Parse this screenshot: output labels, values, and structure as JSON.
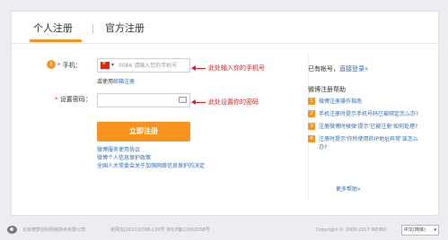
{
  "tabs": {
    "personal": "个人注册",
    "official": "官方注册"
  },
  "form": {
    "phone_label": "手机：",
    "phone_code": "0086",
    "phone_placeholder": "请输入您的手机号",
    "phone_annotation": "此处输入你的手机号",
    "email_link_prefix": "或使用",
    "email_link": "邮箱注册",
    "password_label": "设置密码：",
    "password_annotation": "此处设置你的密码",
    "submit_label": "立即注册",
    "links": [
      "微博服务使用协议",
      "微博个人信息保护政策",
      "全国人大常委会关于加强网络信息保护的决定"
    ],
    "warn_icon": "!"
  },
  "sidebar": {
    "has_account_prefix": "已有帐号，",
    "login_link": "直接登录»",
    "help_title": "微博注册帮助",
    "help_items": [
      {
        "num": "1",
        "text": "微博注册操作指南"
      },
      {
        "num": "2",
        "text": "手机注册时提示手机号码已被绑定怎么办?"
      },
      {
        "num": "3",
        "text": "注册微博时候弹'提示'已被注册'如何处理?"
      },
      {
        "num": "4",
        "text": "注册时提示'你所使用的IP地址异常'该怎么办?"
      }
    ],
    "more_help": "更多帮助»"
  },
  "footer": {
    "company": "北京微梦创科网络技术有限公司",
    "icp": "京网文[2011]0398-130号 京ICP备12002058号",
    "copyright": "Copyright © 2009-2017 WEIBO",
    "language": "中文(简体)"
  },
  "colors": {
    "accent": "#f7931e",
    "link": "#2c6bb5",
    "annotation": "#e02020"
  },
  "icons": [
    "warning-icon",
    "china-flag-icon",
    "keyboard-icon",
    "weibo-logo-icon"
  ]
}
